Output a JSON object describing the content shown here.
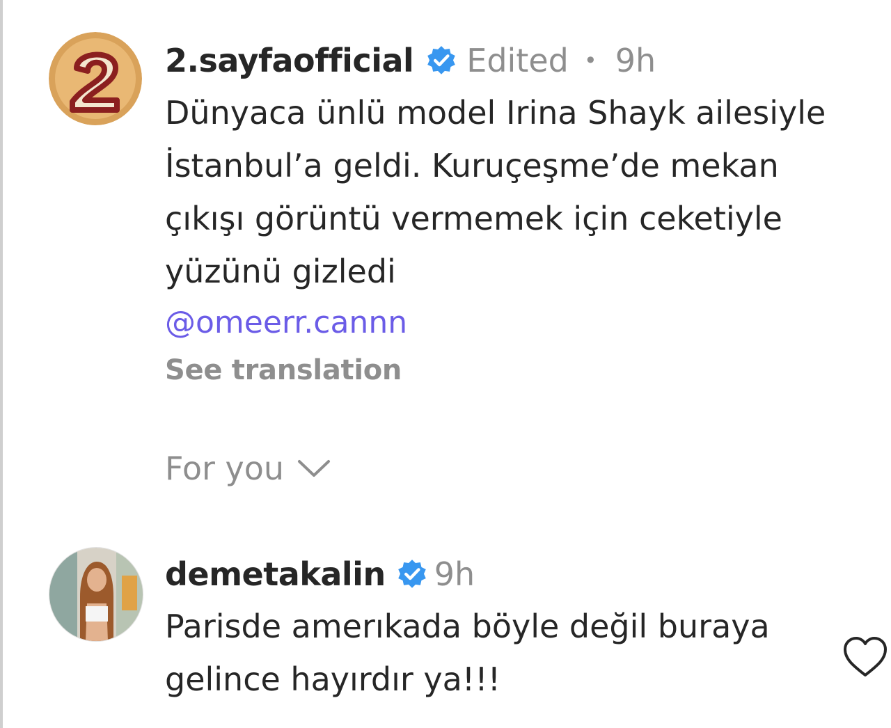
{
  "post": {
    "username": "2.sayfaofficial",
    "edited": "Edited",
    "separator": "•",
    "time": "9h",
    "caption": "Dünyaca ünlü model Irina Shayk ailesiyle İstanbul’a geldi. Kuruçeşme’de mekan çıkışı görüntü vermemek için ceketiyle yüzünü gizledi",
    "mention": "@omeerr.cannn",
    "see_translation": "See translation",
    "avatar_icon": "logo-2-icon"
  },
  "sort": {
    "label": "For you",
    "icon": "chevron-down-icon"
  },
  "comment": {
    "username": "demetakalin",
    "time": "9h",
    "text": "Parisde amerıkada böyle değil buraya gelince hayırdır ya!!!",
    "like_icon": "heart-icon"
  },
  "colors": {
    "verified": "#3897f0",
    "mention": "#6b5ce7",
    "muted": "#8e8e8e",
    "logo_bg": "#d9a25a",
    "logo_digit": "#8b1f1f"
  }
}
